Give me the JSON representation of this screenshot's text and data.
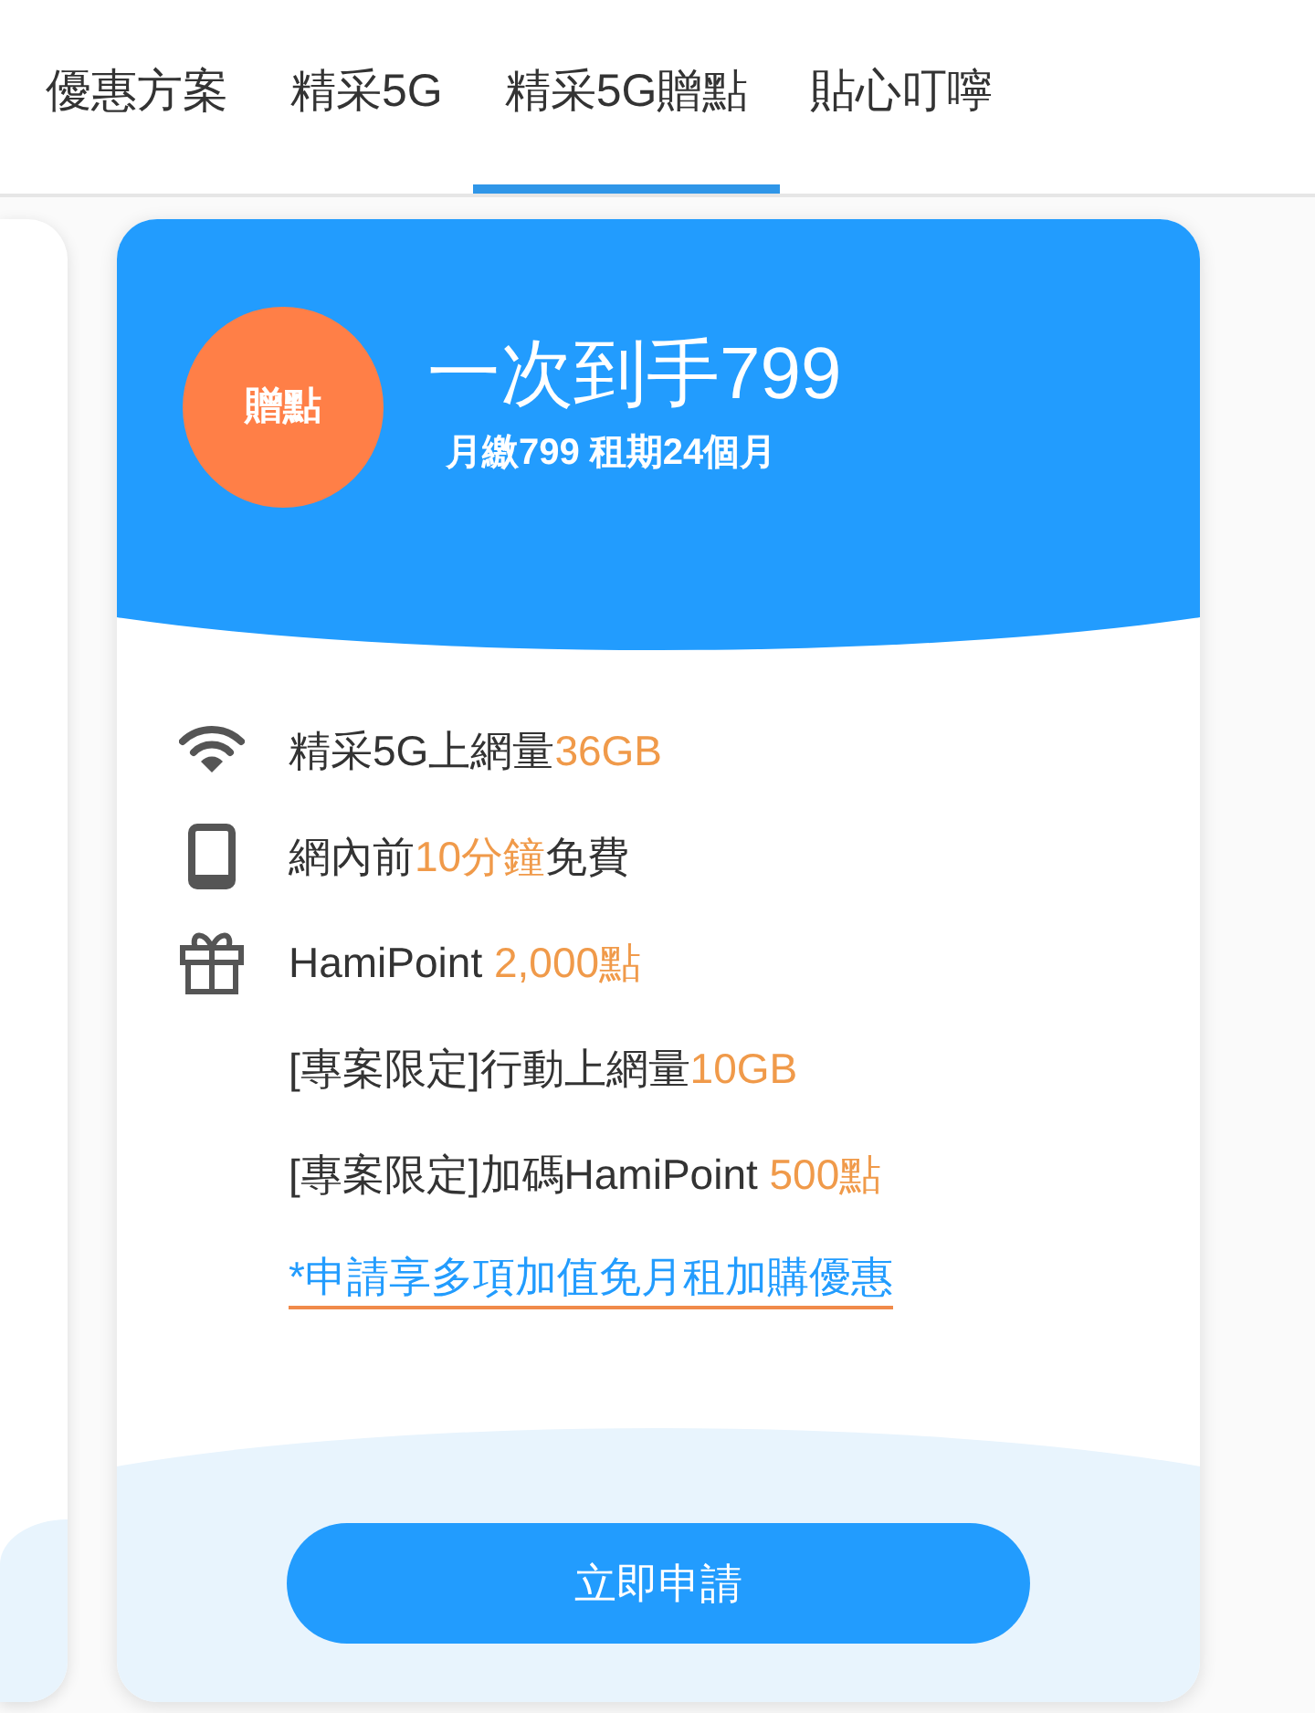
{
  "tabs": [
    {
      "label": "優惠方案",
      "selected": false
    },
    {
      "label": "精采5G",
      "selected": false
    },
    {
      "label": "精采5G贈點",
      "selected": true
    },
    {
      "label": "貼心叮嚀",
      "selected": false
    }
  ],
  "plan": {
    "badge": "贈點",
    "title": "一次到手799",
    "subtitle": "月繳799 租期24個月",
    "features": [
      {
        "kind": "wifi",
        "parts": [
          {
            "text": "精采5G上網量",
            "highlight": false
          },
          {
            "text": "36GB",
            "highlight": true
          }
        ]
      },
      {
        "kind": "phone",
        "parts": [
          {
            "text": "網內前",
            "highlight": false
          },
          {
            "text": "10分鐘",
            "highlight": true
          },
          {
            "text": "免費",
            "highlight": false
          }
        ]
      },
      {
        "kind": "gift",
        "parts": [
          {
            "text": "HamiPoint ",
            "highlight": false
          },
          {
            "text": "2,000點",
            "highlight": true
          }
        ]
      },
      {
        "kind": "none",
        "parts": [
          {
            "text": "[專案限定]行動上網量",
            "highlight": false
          },
          {
            "text": "10GB",
            "highlight": true
          }
        ]
      },
      {
        "kind": "none",
        "parts": [
          {
            "text": "[專案限定]加碼HamiPoint ",
            "highlight": false
          },
          {
            "text": "500點",
            "highlight": true
          }
        ]
      }
    ],
    "link": "*申請享多項加值免月租加購優惠",
    "button": "立即申請"
  }
}
